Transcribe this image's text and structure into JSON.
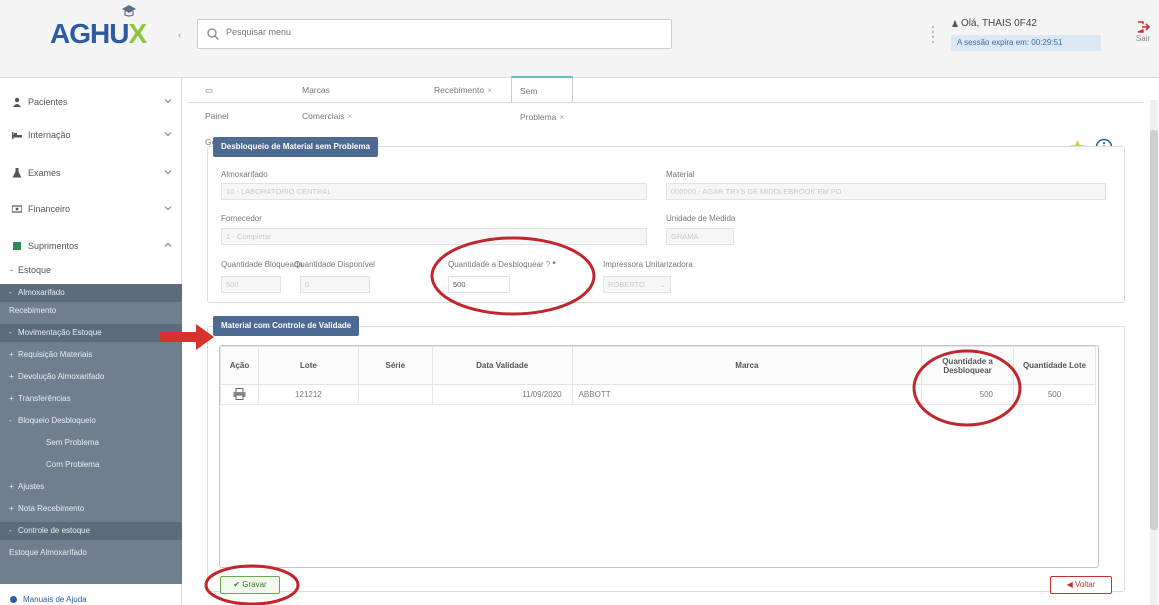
{
  "header": {
    "logo_main": "AGHU",
    "logo_accent": "X",
    "search_placeholder": "Pesquisar menu",
    "user_greeting": "Olá, THAIS 0F42",
    "session_text": "A sessão expira em: 00:29:51",
    "logout_label": "Sair"
  },
  "sidebar": {
    "items": [
      {
        "label": "Pacientes",
        "icon": "person-icon"
      },
      {
        "label": "Internação",
        "icon": "bed-icon"
      },
      {
        "label": "Exames",
        "icon": "flask-icon"
      },
      {
        "label": "Financeiro",
        "icon": "money-icon"
      },
      {
        "label": "Suprimentos",
        "icon": "box-icon"
      }
    ],
    "estoque": "Estoque",
    "sub_items": [
      {
        "prefix": "-",
        "label": "Almoxarifado"
      },
      {
        "prefix": "",
        "label": "Recebimento"
      },
      {
        "prefix": "-",
        "label": "Movimentação Estoque"
      },
      {
        "prefix": "+",
        "label": "Requisição Materiais"
      },
      {
        "prefix": "+",
        "label": "Devolução Almoxarifado"
      },
      {
        "prefix": "+",
        "label": "Transferências"
      },
      {
        "prefix": "-",
        "label": "Bloqueio Desbloqueio"
      },
      {
        "prefix": "",
        "label": "Sem Problema"
      },
      {
        "prefix": "",
        "label": "Com Problema"
      },
      {
        "prefix": "+",
        "label": "Ajustes"
      },
      {
        "prefix": "+",
        "label": "Nota Recebimento"
      },
      {
        "prefix": "-",
        "label": "Controle de estoque"
      },
      {
        "prefix": "",
        "label": "Estoque Almoxarifado"
      }
    ],
    "help": "Manuais de Ajuda"
  },
  "tabs": [
    {
      "label": "Painel Geral"
    },
    {
      "label": "Marcas Comerciais"
    },
    {
      "label": "Recebimento"
    },
    {
      "label": "Sem Problema"
    }
  ],
  "form": {
    "panel_title": "Desbloqueio de Material sem Problema",
    "almoxarifado_label": "Almoxarifado",
    "almoxarifado_value": "10 - LABORATORIO CENTRAL",
    "material_label": "Material",
    "material_value": "000000 - AGAR TRYS DE MIDDLEBROOK EM PO",
    "fornecedor_label": "Fornecedor",
    "fornecedor_value": "1 - Completar",
    "unidade_label": "Unidade de Medida",
    "unidade_value": "GRAMA",
    "qtd_bloqueada_label": "Quantidade Bloqueada",
    "qtd_bloqueada_value": "500",
    "qtd_disponivel_label": "Quantidade Disponível",
    "qtd_disponivel_value": "0",
    "qtd_desbloquear_label": "Quantidade a Desbloquear",
    "qtd_desbloquear_value": "500",
    "impressora_label": "Impressora Unitarizadora",
    "impressora_value": "ROBERTO"
  },
  "validade": {
    "panel_title": "Material com Controle de Validade",
    "columns": [
      "Ação",
      "Lote",
      "Série",
      "Data Validade",
      "Marca",
      "Quantidade a Desbloquear",
      "Quantidade Lote"
    ],
    "rows": [
      {
        "lote": "121212",
        "serie": "",
        "data_validade": "11/09/2020",
        "marca": "ABBOTT",
        "qtd_desbloquear": "500",
        "qtd_lote": "500"
      }
    ]
  },
  "buttons": {
    "save": "Gravar",
    "back": "Voltar"
  },
  "colors": {
    "brand": "#2d5aa0",
    "accent_green": "#8ec63f",
    "panel_header": "#4d6a92",
    "sidebar_sub": "#6f7f8f",
    "annotation_red": "#c0272d"
  }
}
